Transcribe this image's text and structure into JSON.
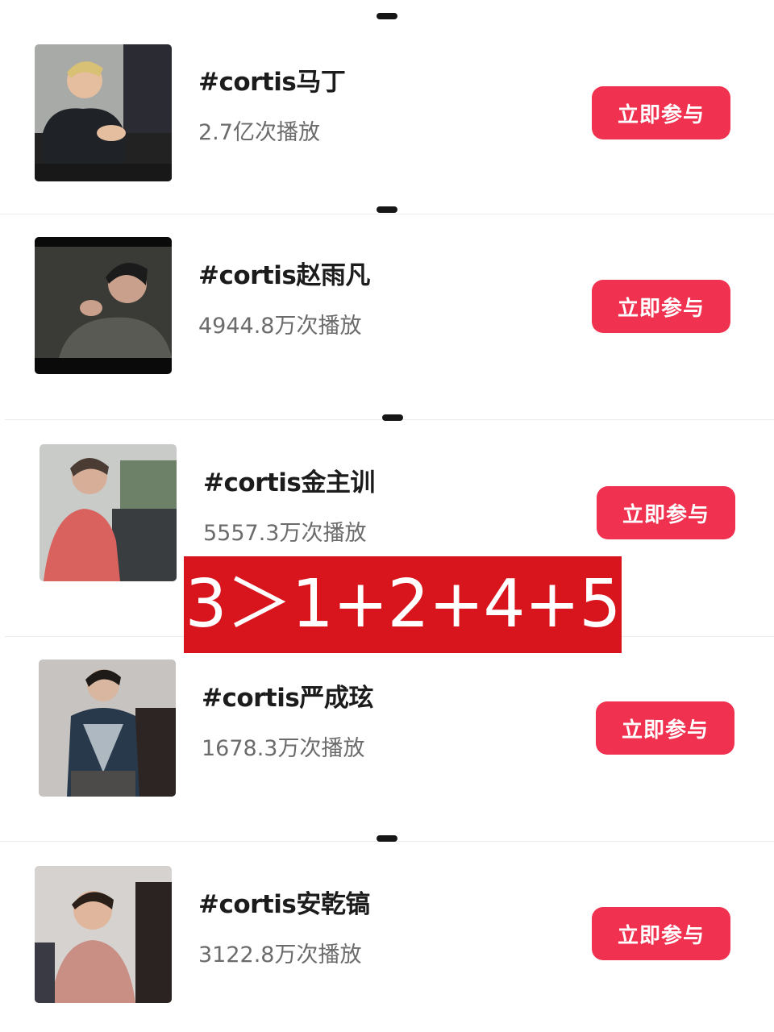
{
  "topics": [
    {
      "title": "#cortis马丁",
      "views": "2.7亿次播放",
      "button": "立即参与"
    },
    {
      "title": "#cortis赵雨凡",
      "views": "4944.8万次播放",
      "button": "立即参与"
    },
    {
      "title": "#cortis金主训",
      "views": "5557.3万次播放",
      "button": "立即参与"
    },
    {
      "title": "#cortis严成玹",
      "views": "1678.3万次播放",
      "button": "立即参与"
    },
    {
      "title": "#cortis安乾镐",
      "views": "3122.8万次播放",
      "button": "立即参与"
    }
  ],
  "overlay_text": "3＞1+2+4+5",
  "colors": {
    "button_bg": "#f03150",
    "overlay_bg": "#d8141c"
  }
}
